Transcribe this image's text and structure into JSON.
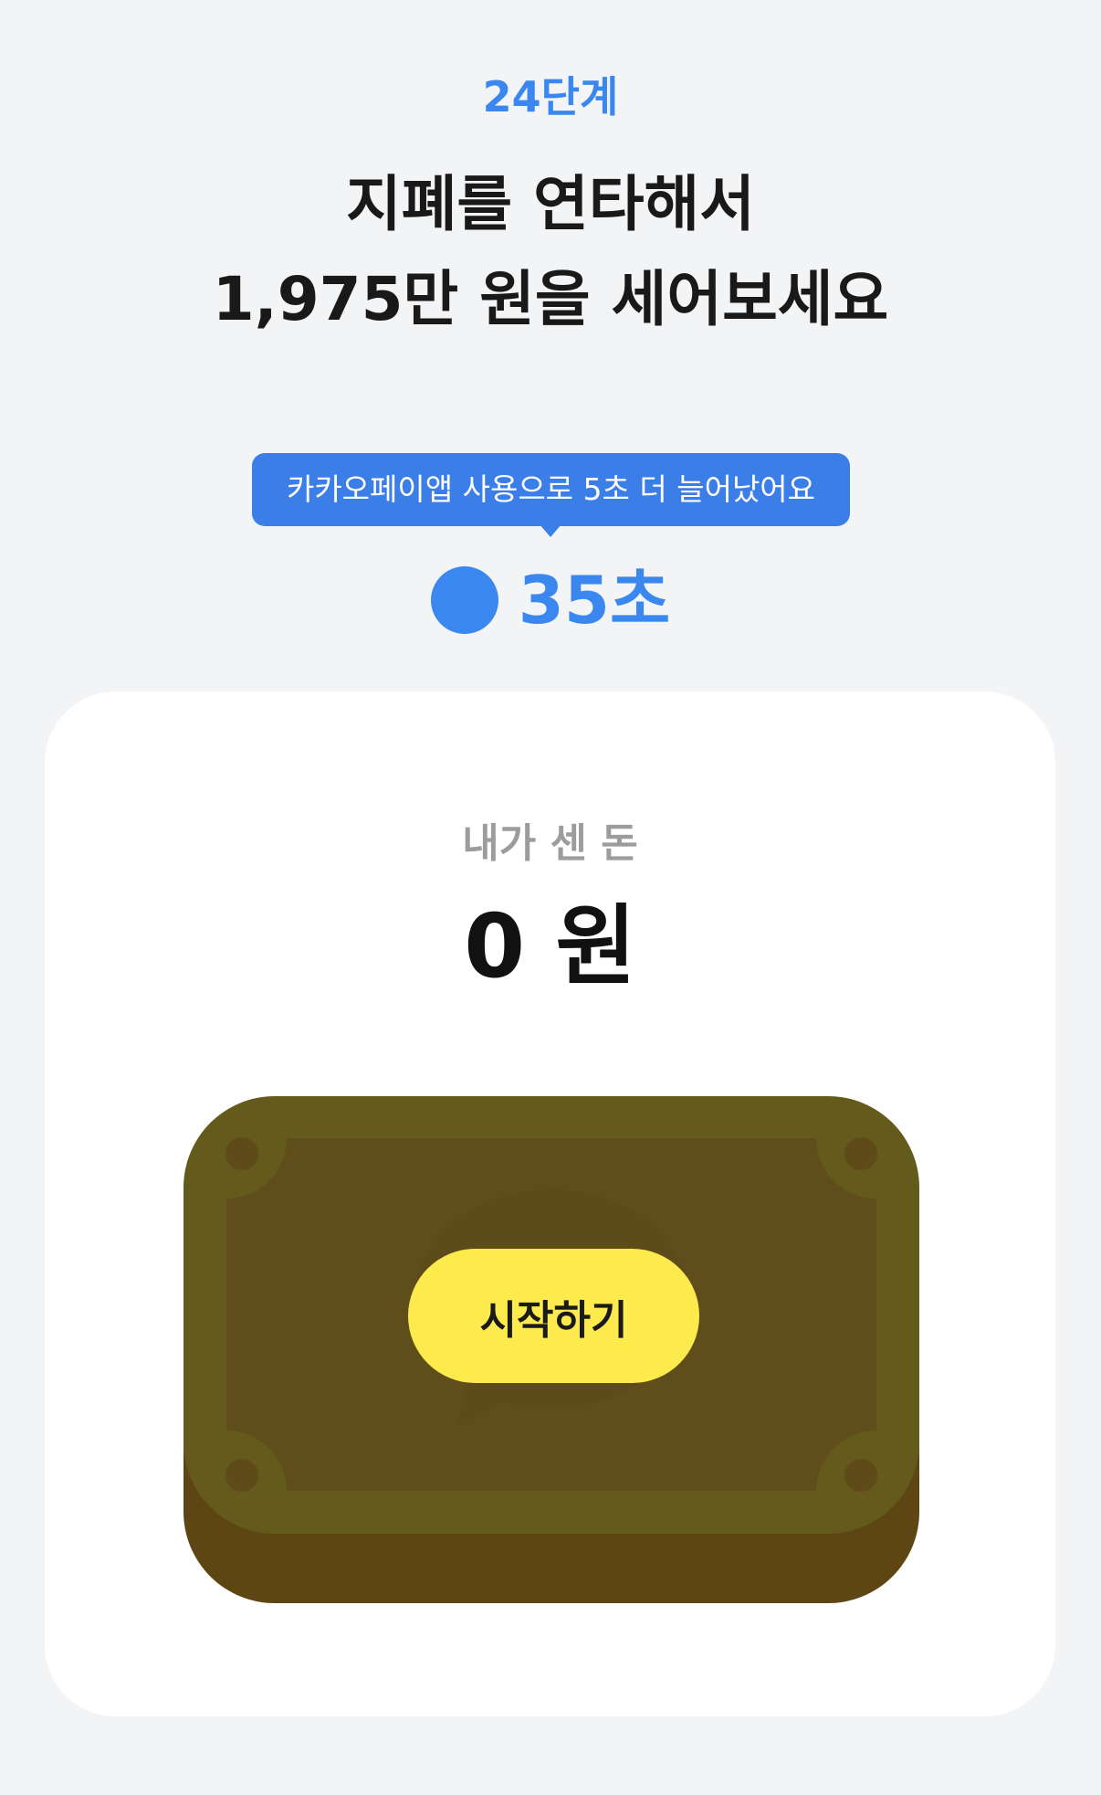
{
  "header": {
    "stage": "24단계",
    "title_line1": "지폐를 연타해서",
    "title_line2": "1,975만 원을 세어보세요"
  },
  "tooltip": {
    "text": "카카오페이앱 사용으로 5초 더 늘어났어요"
  },
  "timer": {
    "value": "35초"
  },
  "counter": {
    "label": "내가 센 돈",
    "value": "0 원"
  },
  "bill": {
    "start_label": "시작하기"
  },
  "colors": {
    "background": "#f3f4f6",
    "accent_blue": "#3b87f0",
    "tooltip_blue": "#3b7ee8",
    "bill_face": "#635a1b",
    "bill_base": "#5e4514",
    "start_button": "#fdeb4e"
  }
}
